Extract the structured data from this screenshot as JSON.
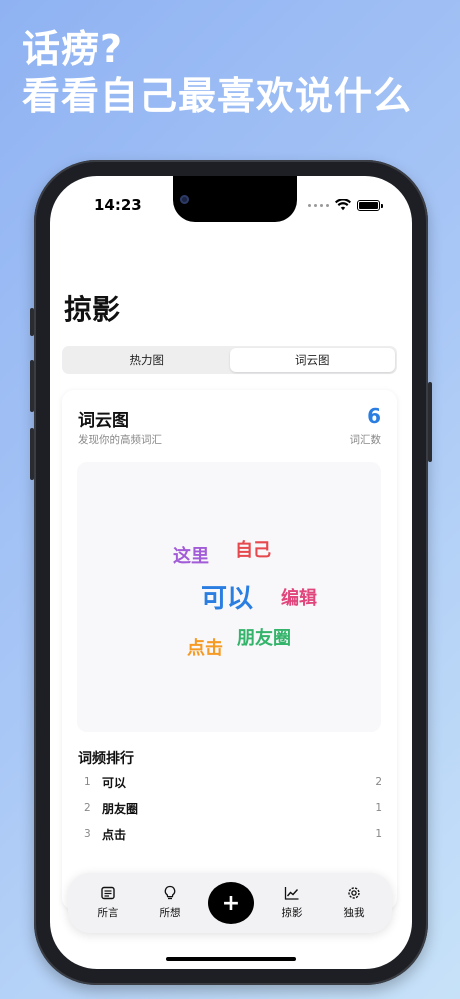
{
  "headline": {
    "line1": "话痨?",
    "line2": "看看自己最喜欢说什么"
  },
  "status_bar": {
    "time": "14:23"
  },
  "page": {
    "title": "掠影"
  },
  "segmented": {
    "heatmap_label": "热力图",
    "wordcloud_label": "词云图",
    "active": "词云图"
  },
  "card": {
    "title": "词云图",
    "subtitle": "发现你的高频词汇",
    "vocab_count": "6",
    "vocab_label": "词汇数"
  },
  "word_cloud": [
    {
      "text": "这里",
      "color": "#a35cd8"
    },
    {
      "text": "自己",
      "color": "#e5484d"
    },
    {
      "text": "可以",
      "color": "#2a7de1"
    },
    {
      "text": "编辑",
      "color": "#e0457b"
    },
    {
      "text": "点击",
      "color": "#f59a23"
    },
    {
      "text": "朋友圈",
      "color": "#34b36a"
    }
  ],
  "ranking": {
    "title": "词频排行",
    "rows": [
      {
        "index": "1",
        "word": "可以",
        "count": "2"
      },
      {
        "index": "2",
        "word": "朋友圈",
        "count": "1"
      },
      {
        "index": "3",
        "word": "点击",
        "count": "1"
      }
    ]
  },
  "tabbar": {
    "tab1": {
      "label": "所言",
      "icon": "note-icon"
    },
    "tab2": {
      "label": "所想",
      "icon": "lightbulb-icon"
    },
    "add": {
      "label": "+"
    },
    "tab3": {
      "label": "掠影",
      "icon": "chart-icon"
    },
    "tab4": {
      "label": "独我",
      "icon": "gear-icon"
    }
  }
}
